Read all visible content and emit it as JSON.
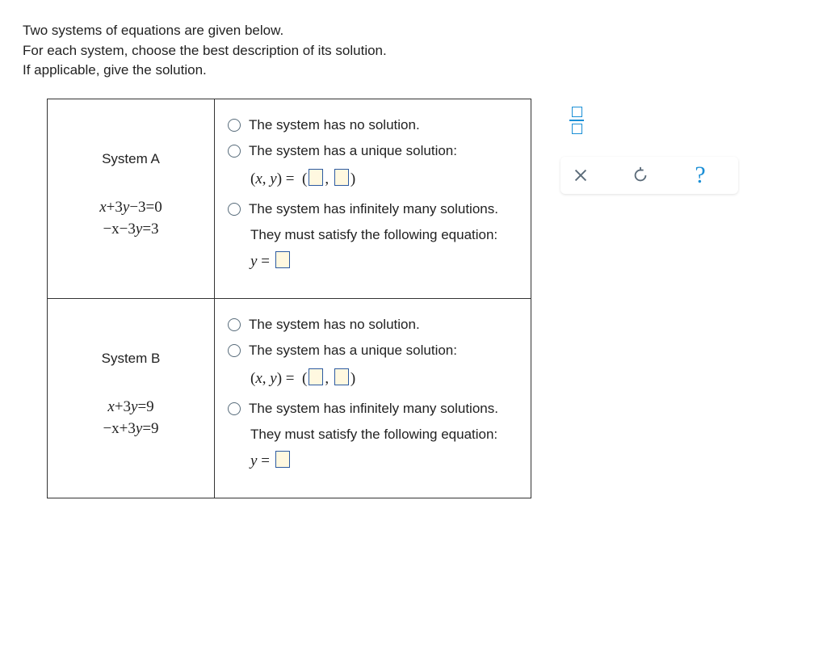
{
  "instructions": {
    "line1": "Two systems of equations are given below.",
    "line2": "For each system, choose the best description of its solution.",
    "line3": "If applicable, give the solution."
  },
  "systems": [
    {
      "name": "System A",
      "eq1": {
        "lhs_prefix": "x",
        "coef2_sign": "+",
        "coef2": "3",
        "var2": "y",
        "tail_sign": "−",
        "tail_num": "3",
        "eq": "=",
        "rhs": "0"
      },
      "eq2": {
        "lhs_prefix": "−x",
        "coef2_sign": "−",
        "coef2": "3",
        "var2": "y",
        "tail_sign": "",
        "tail_num": "",
        "eq": "=",
        "rhs": "3"
      }
    },
    {
      "name": "System B",
      "eq1": {
        "lhs_prefix": "x",
        "coef2_sign": "+",
        "coef2": "3",
        "var2": "y",
        "tail_sign": "",
        "tail_num": "",
        "eq": "=",
        "rhs": "9"
      },
      "eq2": {
        "lhs_prefix": "−x",
        "coef2_sign": "+",
        "coef2": "3",
        "var2": "y",
        "tail_sign": "",
        "tail_num": "",
        "eq": "=",
        "rhs": "9"
      }
    }
  ],
  "options": {
    "no_solution": "The system has no solution.",
    "unique": "The system has a unique solution:",
    "xy_prefix": "(x, y) =",
    "inf": "The system has infinitely many solutions.",
    "follow": "They must satisfy the following equation:",
    "y_eq": "y ="
  },
  "palette": {
    "frac_name": "fraction",
    "close_name": "close",
    "reset_name": "reset",
    "help_name": "help",
    "help_glyph": "?"
  }
}
